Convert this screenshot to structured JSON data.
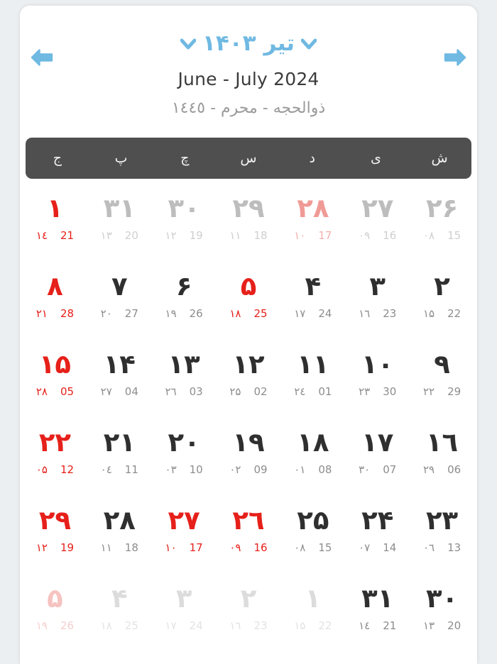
{
  "theme": {
    "page_background": "#ECEFF1",
    "card_background": "#FFFFFF",
    "accent_blue": "#6FB9E2",
    "weekday_bar": "#4F4F4F",
    "holiday_red": "#E6201A",
    "text_dark": "#2F2F2F",
    "text_muted": "#BDBDBD"
  },
  "header": {
    "prev_icon": "arrow-left-icon",
    "next_icon": "arrow-right-icon",
    "chevron_icon": "chevron-down-icon",
    "jalali_title": "تیر ۱۴۰۳",
    "jalali_month": "تیر",
    "jalali_year": "۱۴۰۳",
    "gregorian_title": "June - July 2024",
    "hijri_title": "ذوالحجه - محرم - ۱٤٤٥"
  },
  "weekdays": [
    {
      "label": "ج",
      "name": "friday"
    },
    {
      "label": "پ",
      "name": "thursday"
    },
    {
      "label": "چ",
      "name": "wednesday"
    },
    {
      "label": "س",
      "name": "tuesday"
    },
    {
      "label": "د",
      "name": "monday"
    },
    {
      "label": "ی",
      "name": "sunday"
    },
    {
      "label": "ش",
      "name": "saturday"
    }
  ],
  "weeks": [
    [
      {
        "jalali": "۱",
        "hijri": "۱٤",
        "greg": "21",
        "tone": "red"
      },
      {
        "jalali": "۳۱",
        "hijri": "۱۳",
        "greg": "20",
        "tone": "muted"
      },
      {
        "jalali": "۳۰",
        "hijri": "۱۲",
        "greg": "19",
        "tone": "muted"
      },
      {
        "jalali": "۲۹",
        "hijri": "۱۱",
        "greg": "18",
        "tone": "muted"
      },
      {
        "jalali": "۲۸",
        "hijri": "۱۰",
        "greg": "17",
        "tone": "redmuted"
      },
      {
        "jalali": "۲۷",
        "hijri": "۰۹",
        "greg": "16",
        "tone": "muted"
      },
      {
        "jalali": "۲۶",
        "hijri": "۰۸",
        "greg": "15",
        "tone": "muted"
      }
    ],
    [
      {
        "jalali": "۸",
        "hijri": "۲۱",
        "greg": "28",
        "tone": "red"
      },
      {
        "jalali": "۷",
        "hijri": "۲۰",
        "greg": "27",
        "tone": "dark"
      },
      {
        "jalali": "۶",
        "hijri": "۱۹",
        "greg": "26",
        "tone": "dark"
      },
      {
        "jalali": "۵",
        "hijri": "۱۸",
        "greg": "25",
        "tone": "red"
      },
      {
        "jalali": "۴",
        "hijri": "۱۷",
        "greg": "24",
        "tone": "dark"
      },
      {
        "jalali": "۳",
        "hijri": "۱٦",
        "greg": "23",
        "tone": "dark"
      },
      {
        "jalali": "۲",
        "hijri": "۱۵",
        "greg": "22",
        "tone": "dark"
      }
    ],
    [
      {
        "jalali": "۱۵",
        "hijri": "۲۸",
        "greg": "05",
        "tone": "red"
      },
      {
        "jalali": "۱۴",
        "hijri": "۲۷",
        "greg": "04",
        "tone": "dark"
      },
      {
        "jalali": "۱۳",
        "hijri": "۲٦",
        "greg": "03",
        "tone": "dark"
      },
      {
        "jalali": "۱۲",
        "hijri": "۲۵",
        "greg": "02",
        "tone": "dark"
      },
      {
        "jalali": "۱۱",
        "hijri": "۲٤",
        "greg": "01",
        "tone": "dark"
      },
      {
        "jalali": "۱۰",
        "hijri": "۲۳",
        "greg": "30",
        "tone": "dark"
      },
      {
        "jalali": "۹",
        "hijri": "۲۲",
        "greg": "29",
        "tone": "dark"
      }
    ],
    [
      {
        "jalali": "۲۲",
        "hijri": "۰۵",
        "greg": "12",
        "tone": "red"
      },
      {
        "jalali": "۲۱",
        "hijri": "۰٤",
        "greg": "11",
        "tone": "dark"
      },
      {
        "jalali": "۲۰",
        "hijri": "۰۳",
        "greg": "10",
        "tone": "dark"
      },
      {
        "jalali": "۱۹",
        "hijri": "۰۲",
        "greg": "09",
        "tone": "dark"
      },
      {
        "jalali": "۱۸",
        "hijri": "۰۱",
        "greg": "08",
        "tone": "dark"
      },
      {
        "jalali": "۱۷",
        "hijri": "۳۰",
        "greg": "07",
        "tone": "dark"
      },
      {
        "jalali": "۱٦",
        "hijri": "۲۹",
        "greg": "06",
        "tone": "dark"
      }
    ],
    [
      {
        "jalali": "۲۹",
        "hijri": "۱۲",
        "greg": "19",
        "tone": "red"
      },
      {
        "jalali": "۲۸",
        "hijri": "۱۱",
        "greg": "18",
        "tone": "dark"
      },
      {
        "jalali": "۲۷",
        "hijri": "۱۰",
        "greg": "17",
        "tone": "red"
      },
      {
        "jalali": "۲٦",
        "hijri": "۰۹",
        "greg": "16",
        "tone": "red"
      },
      {
        "jalali": "۲۵",
        "hijri": "۰۸",
        "greg": "15",
        "tone": "dark"
      },
      {
        "jalali": "۲۴",
        "hijri": "۰۷",
        "greg": "14",
        "tone": "dark"
      },
      {
        "jalali": "۲۳",
        "hijri": "۰٦",
        "greg": "13",
        "tone": "dark"
      }
    ],
    [
      {
        "jalali": "۵",
        "hijri": "۱۹",
        "greg": "26",
        "tone": "redfaint"
      },
      {
        "jalali": "۴",
        "hijri": "۱۸",
        "greg": "25",
        "tone": "faint"
      },
      {
        "jalali": "۳",
        "hijri": "۱۷",
        "greg": "24",
        "tone": "faint"
      },
      {
        "jalali": "۲",
        "hijri": "۱٦",
        "greg": "23",
        "tone": "faint"
      },
      {
        "jalali": "۱",
        "hijri": "۱۵",
        "greg": "22",
        "tone": "faint"
      },
      {
        "jalali": "۳۱",
        "hijri": "۱٤",
        "greg": "21",
        "tone": "dark"
      },
      {
        "jalali": "۳۰",
        "hijri": "۱۳",
        "greg": "20",
        "tone": "dark"
      }
    ]
  ]
}
